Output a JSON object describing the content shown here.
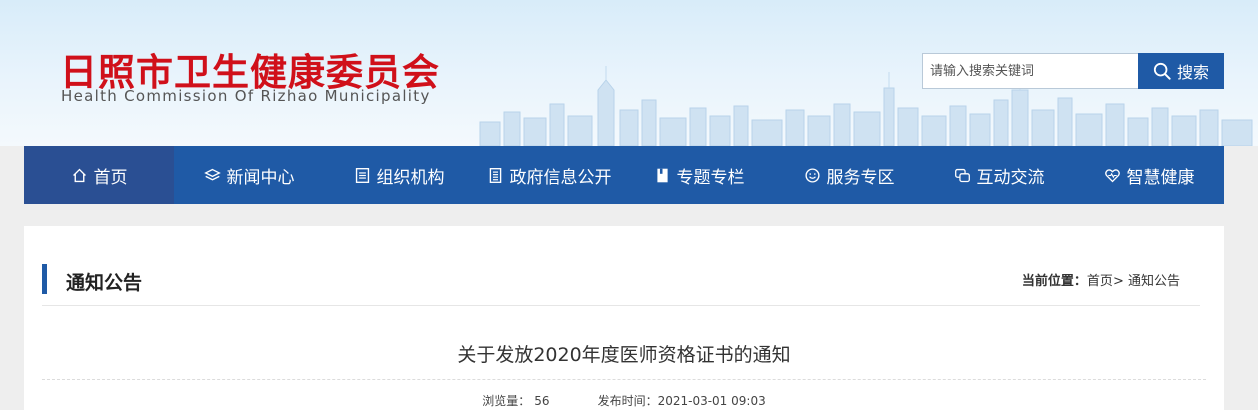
{
  "header": {
    "title_cn": "日照市卫生健康委员会",
    "title_en": "Health Commission Of Rizhao Municipality"
  },
  "search": {
    "placeholder": "请输入搜索关键词",
    "button_label": "搜索"
  },
  "nav": {
    "items": [
      {
        "label": "首页",
        "icon": "home-icon"
      },
      {
        "label": "新闻中心",
        "icon": "layers-icon"
      },
      {
        "label": "组织机构",
        "icon": "org-icon"
      },
      {
        "label": "政府信息公开",
        "icon": "document-icon"
      },
      {
        "label": "专题专栏",
        "icon": "book-icon"
      },
      {
        "label": "服务专区",
        "icon": "smile-icon"
      },
      {
        "label": "互动交流",
        "icon": "chat-icon"
      },
      {
        "label": "智慧健康",
        "icon": "heart-icon"
      }
    ]
  },
  "section": {
    "title": "通知公告",
    "breadcrumb_label": "当前位置：",
    "breadcrumb_home": "首页",
    "breadcrumb_sep": ">",
    "breadcrumb_current": "通知公告"
  },
  "article": {
    "title": "关于发放2020年度医师资格证书的通知",
    "views_label": "浏览量：",
    "views": "56",
    "published_label": "发布时间：",
    "published": "2021-03-01 09:03"
  },
  "colors": {
    "brand_red": "#d0101a",
    "nav_blue": "#1f5aa6",
    "nav_active": "#2a4f93"
  }
}
